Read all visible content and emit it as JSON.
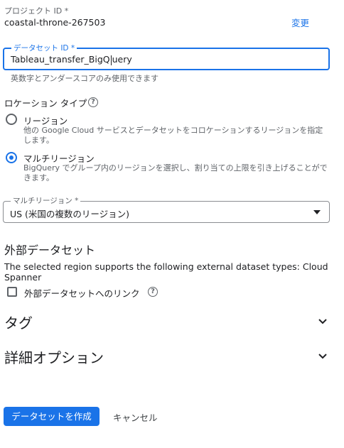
{
  "project": {
    "label": "プロジェクト ID *",
    "value": "coastal-throne-267503",
    "change_link": "変更"
  },
  "dataset_id": {
    "label": "データセット ID *",
    "value_before_caret": "Tableau_transfer_BigQ",
    "value_after_caret": "uery",
    "hint": "英数字とアンダースコアのみ使用できます"
  },
  "location_type": {
    "label": "ロケーション タイプ",
    "options": [
      {
        "title": "リージョン",
        "description": "他の Google Cloud サービスとデータセットをコロケーションするリージョンを指定します。",
        "selected": false
      },
      {
        "title": "マルチリージョン",
        "description": "BigQuery でグループ内のリージョンを選択し、割り当ての上限を引き上げることができます。",
        "selected": true
      }
    ]
  },
  "multi_region": {
    "label": "マルチリージョン *",
    "value": "US (米国の複数のリージョン)"
  },
  "external_dataset": {
    "title": "外部データセット",
    "support_text": "The selected region supports the following external dataset types: Cloud Spanner",
    "checkbox_label": "外部データセットへのリンク",
    "checked": false
  },
  "sections": {
    "tags": "タグ",
    "advanced": "詳細オプション"
  },
  "actions": {
    "create": "データセットを作成",
    "cancel": "キャンセル"
  },
  "colors": {
    "accent": "#1a73e8",
    "text": "#202124",
    "muted": "#5f6368",
    "border": "#dadce0"
  },
  "icons": [
    "help-icon",
    "chevron-down-icon",
    "dropdown-arrow-icon",
    "radio-icon",
    "checkbox-icon"
  ]
}
